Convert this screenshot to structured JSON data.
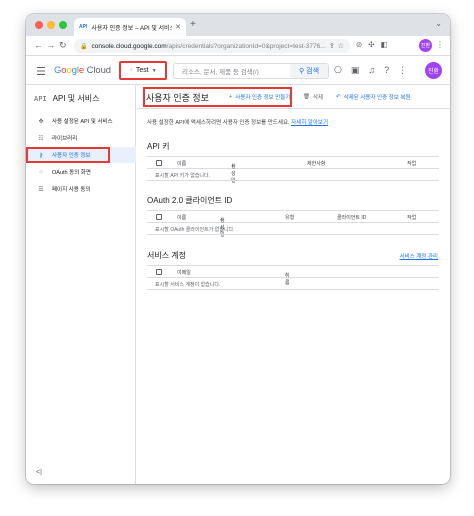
{
  "browser": {
    "tab_title": "사용자 인증 정보 – API 및 서비스 ...",
    "tab_favicon": "API",
    "new_tab": "+",
    "url_host": "console.cloud.google.com",
    "url_path": "/apis/credentials?organizationId=0&project=test-3776...",
    "profile_initials": "진환"
  },
  "header": {
    "logo_parts": [
      "G",
      "o",
      "o",
      "g",
      "l",
      "e"
    ],
    "logo_cloud": "Cloud",
    "project_name": "Test",
    "search_placeholder": "리소스, 문서, 제품 등 검색(/)",
    "search_button": "검색",
    "user_initials": "진환"
  },
  "sidebar": {
    "api_mark": "API",
    "title": "API 및 서비스",
    "items": [
      {
        "label": "사용 설정된 API 및 서비스",
        "icon": "dashboard-icon"
      },
      {
        "label": "라이브러리",
        "icon": "library-icon"
      },
      {
        "label": "사용자 인증 정보",
        "icon": "key-icon"
      },
      {
        "label": "OAuth 동의 화면",
        "icon": "consent-icon"
      },
      {
        "label": "페이지 사용 동의",
        "icon": "agreement-icon"
      }
    ],
    "collapse": "<|"
  },
  "main": {
    "title": "사용자 인증 정보",
    "create_label": "사용자 인증 정보 만들기",
    "delete_label": "삭제",
    "restore_label": "삭제된 사용자 인증 정보 복원",
    "intro": "사용 설정한 API에 액세스하려면 사용자 인증 정보를 만드세요.",
    "learn_more": "자세히 알아보기",
    "api_keys": {
      "title": "API 키",
      "columns": [
        "이름",
        "생성일",
        "제한사항",
        "작업"
      ],
      "empty": "표시할 API 키가 없습니다."
    },
    "oauth": {
      "title": "OAuth 2.0 클라이언트 ID",
      "columns": [
        "이름",
        "생성일",
        "유형",
        "클라이언트 ID",
        "작업"
      ],
      "empty": "표시할 OAuth 클라이언트가 없습니다."
    },
    "service_accounts": {
      "title": "서비스 계정",
      "manage": "서비스 계정 관리",
      "columns": [
        "이메일",
        "이름"
      ],
      "empty": "표시할 서비스 계정이 없습니다."
    }
  },
  "colors": {
    "accent": "#1a73e8",
    "highlight_box": "#e53935",
    "active_bg": "#e8f0fe"
  }
}
